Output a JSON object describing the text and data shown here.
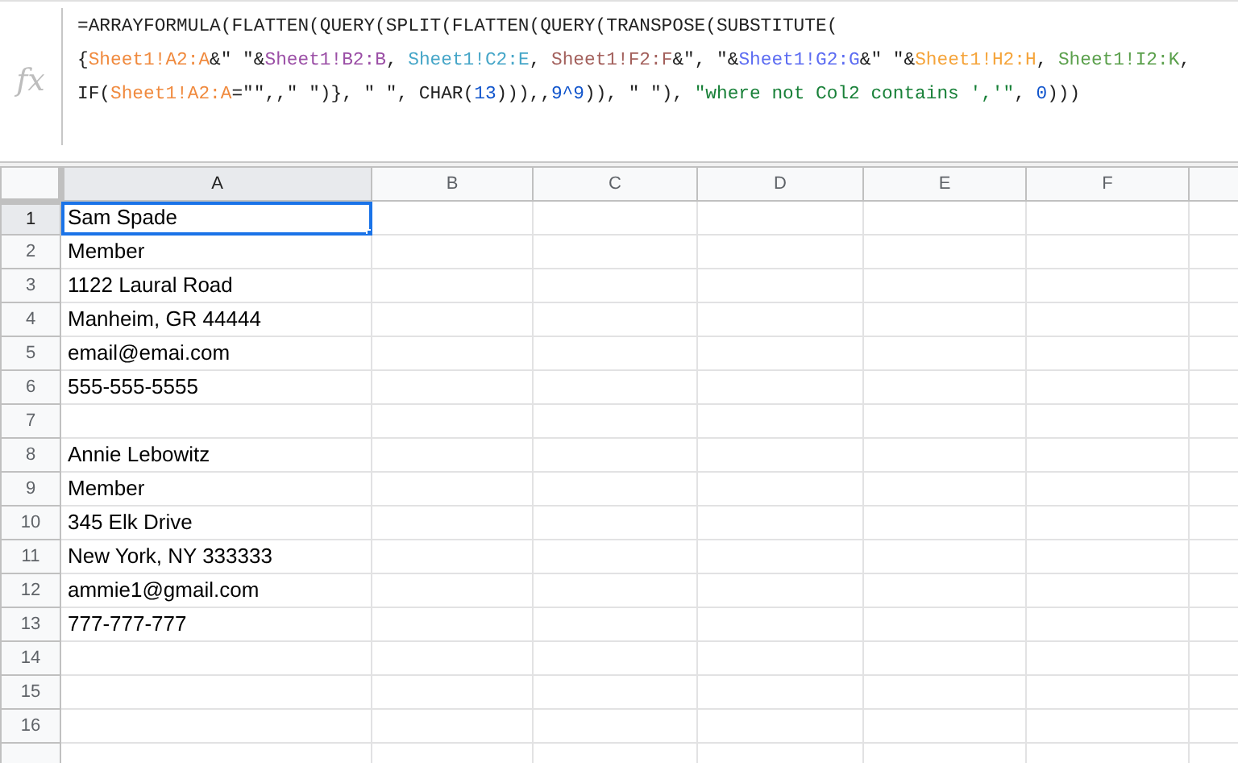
{
  "formula_bar": {
    "icon_text": "fx",
    "lines": [
      [
        {
          "text": "=ARRAYFORMULA(FLATTEN(QUERY(SPLIT(FLATTEN(QUERY(TRANSPOSE(SUBSTITUTE(",
          "color": "#222222"
        }
      ],
      [
        {
          "text": "{",
          "color": "#222222"
        },
        {
          "text": "Sheet1!A2:A",
          "color": "#f08a3e"
        },
        {
          "text": "&\" \"&",
          "color": "#222222"
        },
        {
          "text": "Sheet1!B2:B",
          "color": "#9b4fa6"
        },
        {
          "text": ", ",
          "color": "#222222"
        },
        {
          "text": "Sheet1!C2:E",
          "color": "#46a6c8"
        },
        {
          "text": ", ",
          "color": "#222222"
        },
        {
          "text": "Sheet1!F2:F",
          "color": "#a3605c"
        },
        {
          "text": "&\", \"&",
          "color": "#222222"
        },
        {
          "text": "Sheet1!G2:G",
          "color": "#5c6cf2"
        },
        {
          "text": "&\" \"&",
          "color": "#222222"
        },
        {
          "text": "Sheet1!H2:H",
          "color": "#f5a43a"
        },
        {
          "text": ", ",
          "color": "#222222"
        },
        {
          "text": "Sheet1!I2:K",
          "color": "#5ba04c"
        },
        {
          "text": ",",
          "color": "#222222"
        }
      ],
      [
        {
          "text": "IF(",
          "color": "#222222"
        },
        {
          "text": "Sheet1!A2:A",
          "color": "#f08a3e"
        },
        {
          "text": "=\"\",,\" \")}, \" \", CHAR(",
          "color": "#222222"
        },
        {
          "text": "13",
          "color": "#1155cc"
        },
        {
          "text": "))),,",
          "color": "#222222"
        },
        {
          "text": "9^9",
          "color": "#1155cc"
        },
        {
          "text": ")), \" \"), ",
          "color": "#222222"
        },
        {
          "text": "\"where not Col2 contains ','\"",
          "color": "#188038"
        },
        {
          "text": ", ",
          "color": "#222222"
        },
        {
          "text": "0",
          "color": "#1155cc"
        },
        {
          "text": ")))",
          "color": "#222222"
        }
      ]
    ]
  },
  "columns": [
    {
      "label": "A",
      "selected": true
    },
    {
      "label": "B",
      "selected": false
    },
    {
      "label": "C",
      "selected": false
    },
    {
      "label": "D",
      "selected": false
    },
    {
      "label": "E",
      "selected": false
    },
    {
      "label": "F",
      "selected": false
    }
  ],
  "rows": [
    {
      "number": "1",
      "selected": true,
      "cell_a": {
        "value": "Sam Spade",
        "selected": true
      }
    },
    {
      "number": "2",
      "selected": false,
      "cell_a": {
        "value": "Member",
        "selected": false
      }
    },
    {
      "number": "3",
      "selected": false,
      "cell_a": {
        "value": "1122 Laural Road",
        "selected": false
      }
    },
    {
      "number": "4",
      "selected": false,
      "cell_a": {
        "value": "Manheim, GR 44444",
        "selected": false
      }
    },
    {
      "number": "5",
      "selected": false,
      "cell_a": {
        "value": "email@emai.com",
        "selected": false
      }
    },
    {
      "number": "6",
      "selected": false,
      "cell_a": {
        "value": "555-555-5555",
        "selected": false
      }
    },
    {
      "number": "7",
      "selected": false,
      "cell_a": {
        "selected": false
      }
    },
    {
      "number": "8",
      "selected": false,
      "cell_a": {
        "value": "Annie Lebowitz",
        "selected": false
      }
    },
    {
      "number": "9",
      "selected": false,
      "cell_a": {
        "value": "Member",
        "selected": false
      }
    },
    {
      "number": "10",
      "selected": false,
      "cell_a": {
        "value": "345 Elk Drive",
        "selected": false
      }
    },
    {
      "number": "11",
      "selected": false,
      "cell_a": {
        "value": "New York, NY 333333",
        "selected": false
      }
    },
    {
      "number": "12",
      "selected": false,
      "cell_a": {
        "value": "ammie1@gmail.com",
        "selected": false
      }
    },
    {
      "number": "13",
      "selected": false,
      "cell_a": {
        "value": "777-777-777",
        "selected": false
      }
    },
    {
      "number": "14",
      "selected": false,
      "cell_a": {
        "selected": false
      }
    },
    {
      "number": "15",
      "selected": false,
      "cell_a": {
        "selected": false
      }
    },
    {
      "number": "16",
      "selected": false,
      "cell_a": {
        "selected": false
      }
    }
  ]
}
